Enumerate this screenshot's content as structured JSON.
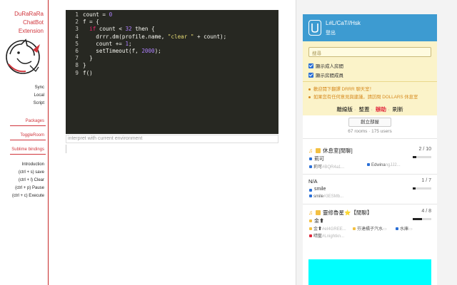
{
  "app": {
    "title_lines": [
      "DuRaRaRa",
      "ChatBot",
      "Extension"
    ],
    "logo_icon": "cat-mascot-icon"
  },
  "sidebar": {
    "links_top": [
      "Sync",
      "Local",
      "Script"
    ],
    "sections": [
      "Packages",
      "ToggleRoom",
      "Sublime bindings"
    ],
    "shortcuts": [
      "Introduction",
      "(ctrl + s) save",
      "(ctrl + l) Clear",
      "(ctrl + p) Pause",
      "(ctrl + c) Execute"
    ]
  },
  "editor": {
    "line_numbers": [
      "1",
      "2",
      "3",
      "4",
      "5",
      "6",
      "7",
      "8",
      "9"
    ],
    "tokens": {
      "l1": [
        "count = ",
        "0"
      ],
      "l2": "f = {",
      "l3": [
        "if",
        " count < ",
        "32",
        " then {"
      ],
      "l4": [
        "drrr.dm(profile.name, ",
        "\"clear \"",
        " + count);"
      ],
      "l5": [
        "count += ",
        "1",
        ";"
      ],
      "l6": [
        "setTimeout(f, ",
        "2000",
        ");"
      ],
      "l7": "}",
      "l8": "}",
      "l9": "f()"
    },
    "placeholder": "interpret with current environment",
    "colors": {
      "background": "#272822",
      "keyword": "#f92672",
      "string": "#e6db74",
      "number": "#ae81ff"
    }
  },
  "chat_panel": {
    "user_name": "L#L/CaT//Hsk",
    "logout_label": "登出",
    "avatar_icon": "tablet-avatar-icon",
    "search_placeholder": "搜尋",
    "checkboxes": [
      {
        "label": "顯示成人房間",
        "checked": true
      },
      {
        "label": "顯示房間成員",
        "checked": true
      }
    ],
    "notices": [
      "歡迎閱下翻譯 DRRR 聊天室！",
      "如果您有任何意見與建議，請訪問 DOLLARS 休息室"
    ],
    "tabs": [
      "離線版",
      "整蓋",
      "辦助",
      "刷新"
    ],
    "active_tab_index": 2,
    "create_room_label": "創立部屋",
    "room_stats": "67 rooms · 175 users",
    "rooms": [
      {
        "title": "休息室[閒聊]",
        "count": "2 / 10",
        "fill": 0.2,
        "host": "莉可",
        "members": [
          {
            "name": "莉可",
            "faded": "#BQR4a1...",
            "color": "#2a6fd6"
          },
          {
            "name": "Edwina",
            "faded": "ngJJ2...",
            "color": "#2a6fd6"
          }
        ],
        "music": true,
        "lock": true
      },
      {
        "title": "N/A",
        "count": "1 / 7",
        "fill": 0.14,
        "host": "smile",
        "members": [
          {
            "name": "smile",
            "faded": "#3ESMb...",
            "color": "#2a6fd6"
          }
        ],
        "music": false,
        "lock": false
      },
      {
        "title": "靈修魯星⭐【閒聊】",
        "count": "4 / 8",
        "fill": 0.5,
        "host": "金⬆",
        "members": [
          {
            "name": "金⬆",
            "faded": "#eI4GREE...",
            "color": "#f3c042"
          },
          {
            "name": "芬達橘子汽水",
            "faded": "▭",
            "color": "#f3c042"
          },
          {
            "name": "水庫",
            "faded": "▭",
            "color": "#2a6fd6"
          },
          {
            "name": "晴藍",
            "faded": "#Lnightkn...",
            "color": "#e0263b"
          }
        ],
        "music": true,
        "lock": true
      }
    ],
    "accent_colors": {
      "header": "#3d9bd1",
      "filter_bg": "#fbf3c9",
      "notice": "#d6891c",
      "ad_block": "#00ffff"
    }
  }
}
